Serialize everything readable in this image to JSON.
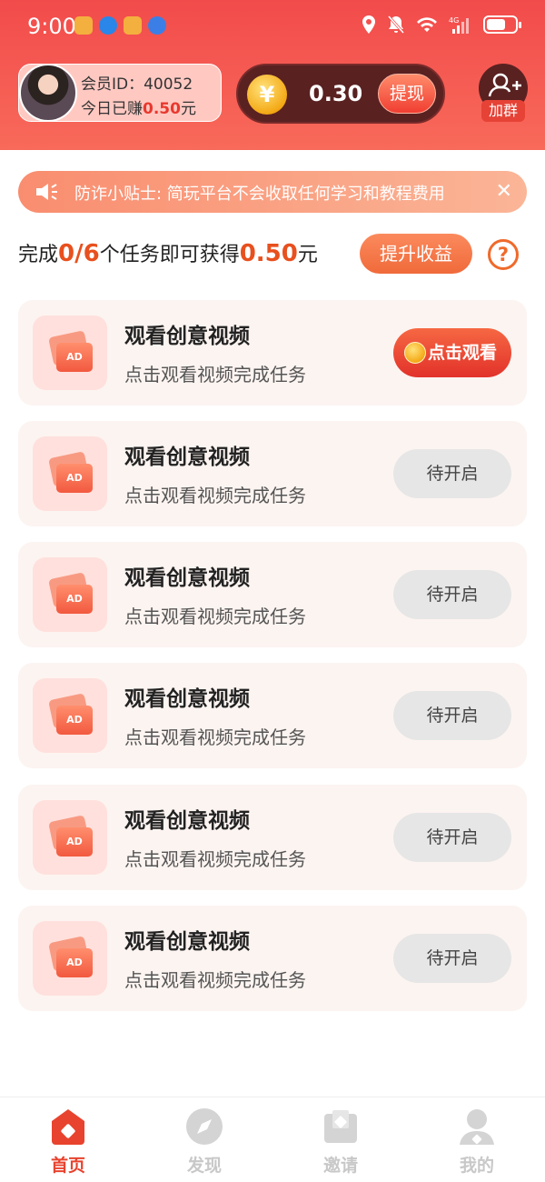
{
  "status_bar": {
    "time": "9:00"
  },
  "header": {
    "member_id_label": "会员ID：40052",
    "earned_prefix": "今日已赚",
    "earned_amount": "0.50",
    "earned_unit": "元",
    "balance": "0.30",
    "coin_symbol": "¥",
    "withdraw_label": "提现",
    "join_group_label": "加群"
  },
  "tip": {
    "text": "防诈小贴士: 简玩平台不会收取任何学习和教程费用"
  },
  "progress": {
    "prefix": "完成",
    "done_total": "0/6",
    "middle": "个任务即可获得",
    "reward": "0.50",
    "unit": "元",
    "boost_label": "提升收益",
    "help_symbol": "?"
  },
  "tasks": [
    {
      "title": "观看创意视频",
      "desc": "点击观看视频完成任务",
      "button": "点击观看",
      "ad_badge": "AD"
    },
    {
      "title": "观看创意视频",
      "desc": "点击观看视频完成任务",
      "button": "待开启",
      "ad_badge": "AD"
    },
    {
      "title": "观看创意视频",
      "desc": "点击观看视频完成任务",
      "button": "待开启",
      "ad_badge": "AD"
    },
    {
      "title": "观看创意视频",
      "desc": "点击观看视频完成任务",
      "button": "待开启",
      "ad_badge": "AD"
    },
    {
      "title": "观看创意视频",
      "desc": "点击观看视频完成任务",
      "button": "待开启",
      "ad_badge": "AD"
    },
    {
      "title": "观看创意视频",
      "desc": "点击观看视频完成任务",
      "button": "待开启",
      "ad_badge": "AD"
    }
  ],
  "nav": [
    {
      "label": "首页",
      "icon": "home-icon",
      "active": true
    },
    {
      "label": "发现",
      "icon": "compass-icon",
      "active": false
    },
    {
      "label": "邀请",
      "icon": "invite-icon",
      "active": false
    },
    {
      "label": "我的",
      "icon": "profile-icon",
      "active": false
    }
  ],
  "colors": {
    "accent": "#e8432e",
    "header": "#f24b4b",
    "balance_card": "#5a2121",
    "highlight": "#e8501e"
  }
}
